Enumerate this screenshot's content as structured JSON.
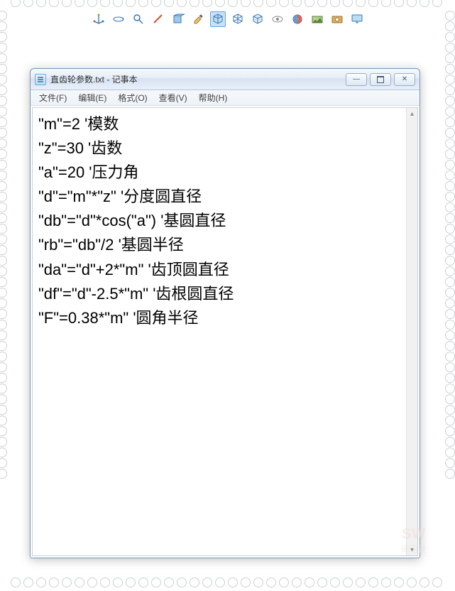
{
  "toolbar_icons": [
    "axis-icon",
    "rotate-view-icon",
    "zoom-icon",
    "measure-icon",
    "section-icon",
    "paint-icon",
    "cube-icon",
    "cube-wire-icon",
    "cube-hidden-icon",
    "view-icon",
    "appearance-icon",
    "scene-icon",
    "capture-icon",
    "display-icon"
  ],
  "selected_tool_index": 6,
  "window": {
    "title": "直齿轮参数.txt - 记事本",
    "menu": [
      "文件(F)",
      "编辑(E)",
      "格式(O)",
      "查看(V)",
      "帮助(H)"
    ],
    "btn_min": "—",
    "btn_close": "✕"
  },
  "editor": {
    "lines": [
      "\"m\"=2 '模数",
      "\"z\"=30 '齿数",
      "\"a\"=20 '压力角",
      "\"d\"=\"m\"*\"z\" '分度圆直径",
      "\"db\"=\"d\"*cos(\"a\") '基圆直径",
      "\"rb\"=\"db\"/2 '基圆半径",
      "\"da\"=\"d\"+2*\"m\" '齿顶圆直径",
      "\"df\"=\"d\"-2.5*\"m\" '齿根圆直径",
      "\"F\"=0.38*\"m\" '圆角半径"
    ]
  },
  "watermark": {
    "top": "SW",
    "bottom": "研习社"
  }
}
